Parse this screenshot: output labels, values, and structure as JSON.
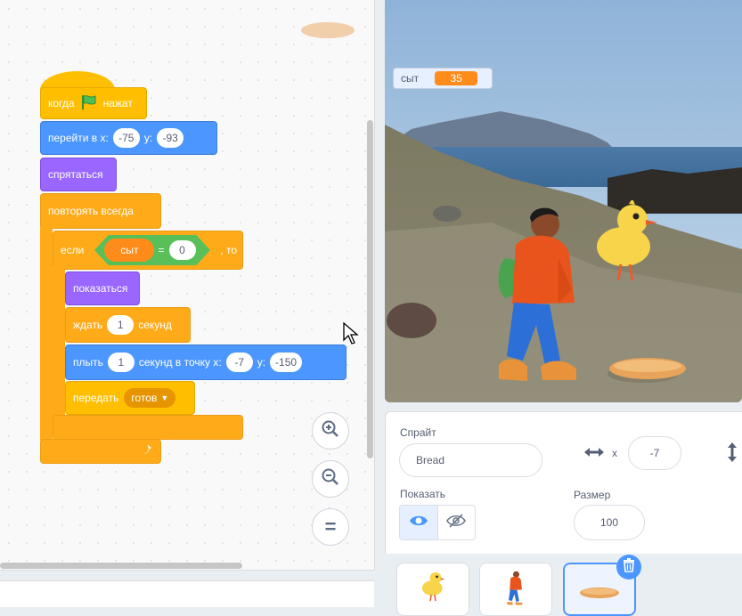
{
  "code": {
    "hat": {
      "label_when": "когда",
      "label_clicked": "нажат"
    },
    "goto": {
      "label": "перейти в x:",
      "x": "-75",
      "y_label": "y:",
      "y": "-93"
    },
    "hide": {
      "label": "спрятаться"
    },
    "forever": {
      "label": "повторять всегда"
    },
    "if": {
      "label_if": "если",
      "label_then": ", то"
    },
    "condition": {
      "variable": "сыт",
      "operator": "=",
      "value": "0"
    },
    "show": {
      "label": "показаться"
    },
    "wait": {
      "label": "ждать",
      "value": "1",
      "unit": "секунд"
    },
    "glide": {
      "label": "плыть",
      "value": "1",
      "middle": "секунд в точку x:",
      "x": "-7",
      "y_label": "y:",
      "y": "-150"
    },
    "broadcast": {
      "label": "передать",
      "message": "готов"
    }
  },
  "zoom": {
    "reset_symbol": "="
  },
  "stage": {
    "monitor": {
      "label": "сыт",
      "value": "35"
    }
  },
  "sprite_info": {
    "sprite_label": "Спрайт",
    "sprite_name": "Bread",
    "x_label": "x",
    "x_value": "-7",
    "show_label": "Показать",
    "size_label": "Размер",
    "size_value": "100"
  },
  "sprites": [
    {
      "name": "Duck",
      "icon": "duck-icon"
    },
    {
      "name": "Boy",
      "icon": "boy-icon"
    },
    {
      "name": "Bread",
      "icon": "bread-icon",
      "selected": true
    }
  ],
  "colors": {
    "events": "#ffbf00",
    "control": "#ffab19",
    "motion": "#4c97ff",
    "looks": "#9966ff",
    "operators": "#59c059",
    "variables": "#ff8c1a"
  }
}
